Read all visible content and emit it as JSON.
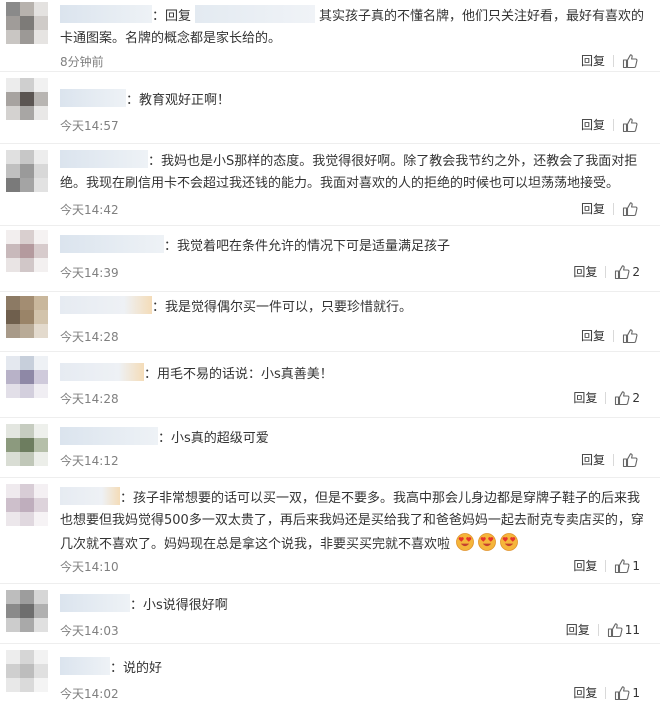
{
  "comments": [
    {
      "reply_word": "回复",
      "text": "其实孩子真的不懂名牌，他们只关注好看，最好有喜欢的卡通图案。名牌的概念都是家长给的。",
      "time": "8分钟前",
      "reply_label": "回复",
      "likes": ""
    },
    {
      "text": "教育观好正啊！",
      "time": "今天14:57",
      "reply_label": "回复",
      "likes": ""
    },
    {
      "text": "我妈也是小S那样的态度。我觉得很好啊。除了教会我节约之外，还教会了我面对拒绝。我现在刷信用卡不会超过我还钱的能力。我面对喜欢的人的拒绝的时候也可以坦荡荡地接受。",
      "time": "今天14:42",
      "reply_label": "回复",
      "likes": ""
    },
    {
      "text": "我觉着吧在条件允许的情况下可是适量满足孩子",
      "time": "今天14:39",
      "reply_label": "回复",
      "likes": "2"
    },
    {
      "text": "我是觉得偶尔买一件可以，只要珍惜就行。",
      "time": "今天14:28",
      "reply_label": "回复",
      "likes": ""
    },
    {
      "text": "用毛不易的话说：小s真善美！",
      "time": "今天14:28",
      "reply_label": "回复",
      "likes": "2"
    },
    {
      "text": "小s真的超级可爱",
      "time": "今天14:12",
      "reply_label": "回复",
      "likes": ""
    },
    {
      "text": "孩子非常想要的话可以买一双，但是不要多。我高中那会儿身边都是穿牌子鞋子的后来我也想要但我妈觉得500多一双太贵了，再后来我妈还是买给我了和爸爸妈妈一起去耐克专卖店买的，穿几次就不喜欢了。妈妈现在总是拿这个说我，非要买买完就不喜欢啦",
      "time": "今天14:10",
      "reply_label": "回复",
      "likes": "1"
    },
    {
      "text": "小s说得很好啊",
      "time": "今天14:03",
      "reply_label": "回复",
      "likes": "11"
    },
    {
      "text": "说的好",
      "time": "今天14:02",
      "reply_label": "回复",
      "likes": "1"
    }
  ],
  "colors": {
    "time": "#808080",
    "text": "#333333",
    "divider": "#eeeeee"
  },
  "icons": {
    "like": "thumbs-up-icon",
    "emoji": "heart-eyes-emoji-icon"
  }
}
